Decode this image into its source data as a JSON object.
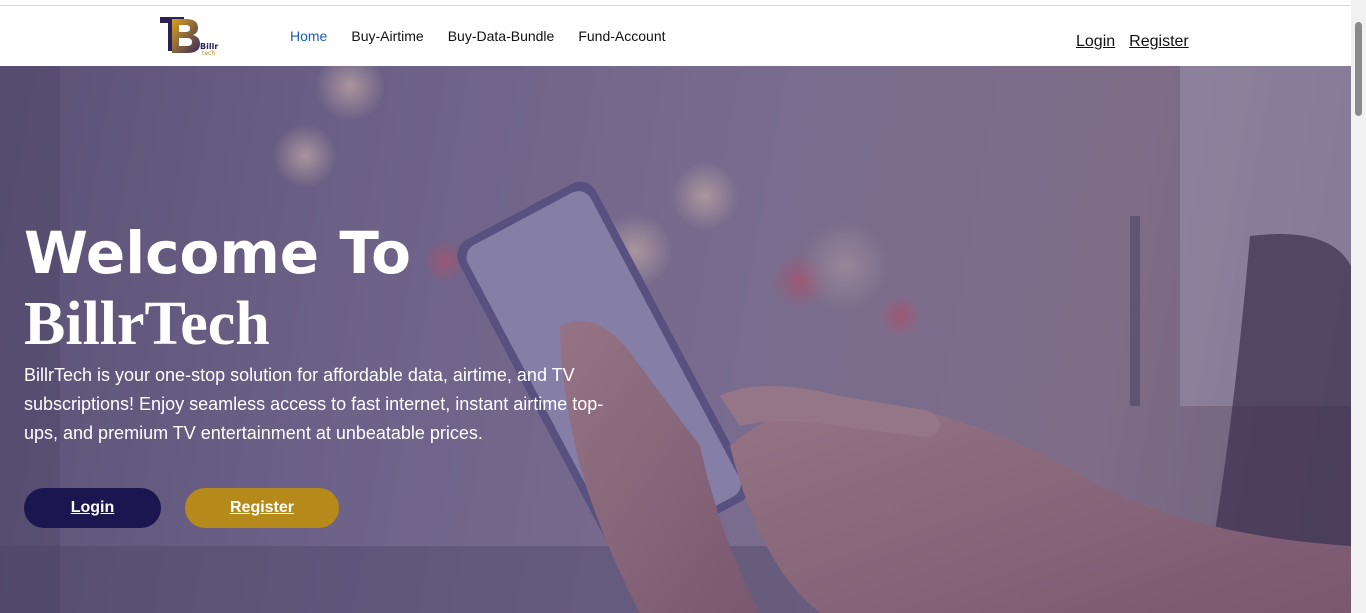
{
  "brand": {
    "logo_letters": "TB",
    "logo_word": "Billr",
    "logo_sub": "tech"
  },
  "nav": {
    "links": [
      {
        "label": "Home"
      },
      {
        "label": "Buy-Airtime"
      },
      {
        "label": "Buy-Data-Bundle"
      },
      {
        "label": "Fund-Account"
      }
    ],
    "login_label": "Login",
    "register_label": "Register"
  },
  "hero": {
    "title_line1": "Welcome To",
    "title_line2": "BillrTech",
    "description": "BillrTech is your one-stop solution for affordable data, airtime, and TV subscriptions! Enjoy seamless access to fast internet, instant airtime top-ups, and premium TV entertainment at unbeatable prices.",
    "login_button": "Login",
    "register_button": "Register"
  },
  "colors": {
    "accent": "#1a5fb4",
    "login_button": "#1b1650",
    "register_button": "#b58a1a"
  }
}
